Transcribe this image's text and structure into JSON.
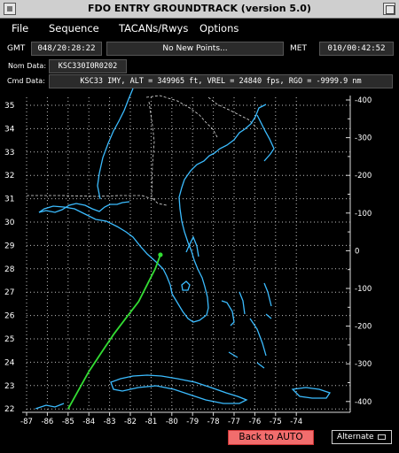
{
  "window": {
    "title": "FDO ENTRY GROUNDTRACK  (version 5.0)"
  },
  "menu": {
    "items": [
      "File",
      "Sequence",
      "TACANs/Rwys",
      "Options"
    ]
  },
  "status": {
    "gmt_label": "GMT",
    "gmt_value": "048/20:28:22",
    "message": "No New Points...",
    "met_label": "MET",
    "met_value": "010/00:42:52"
  },
  "nom_data": {
    "label": "Nom Data:",
    "value": "KSC330I0R0202"
  },
  "cmd_data": {
    "label": "Cmd Data:",
    "value": "KSC33 IMY, ALT = 349965 ft, VREL = 24840 fps, RGO = -9999.9 nm"
  },
  "map": {
    "lat_ticks": [
      "35",
      "34",
      "33",
      "32",
      "31",
      "30",
      "29",
      "28",
      "27",
      "26",
      "25",
      "24",
      "23",
      "22"
    ],
    "lon_ticks": [
      "-87",
      "-86",
      "-85",
      "-84",
      "-83",
      "-82",
      "-81",
      "-80",
      "-79",
      "-78",
      "-77",
      "-76",
      "-75",
      "-74"
    ],
    "crossrange_ticks": [
      "400",
      "300",
      "200",
      "100",
      "0",
      "100",
      "200",
      "300",
      "400"
    ],
    "groundtrack": [
      [
        -85.0,
        22.0
      ],
      [
        -84.5,
        22.8
      ],
      [
        -84.0,
        23.6
      ],
      [
        -83.4,
        24.4
      ],
      [
        -82.8,
        25.2
      ],
      [
        -82.2,
        25.9
      ],
      [
        -81.6,
        26.6
      ],
      [
        -81.2,
        27.3
      ],
      [
        -80.8,
        28.0
      ],
      [
        -80.55,
        28.6
      ]
    ],
    "colors": {
      "coast": "#3bbcff",
      "track": "#33dd33",
      "border": "#dddddd",
      "grid": "#ffffff"
    }
  },
  "bottom": {
    "back_to_auto": "Back to AUTO",
    "alternate": "Alternate"
  }
}
